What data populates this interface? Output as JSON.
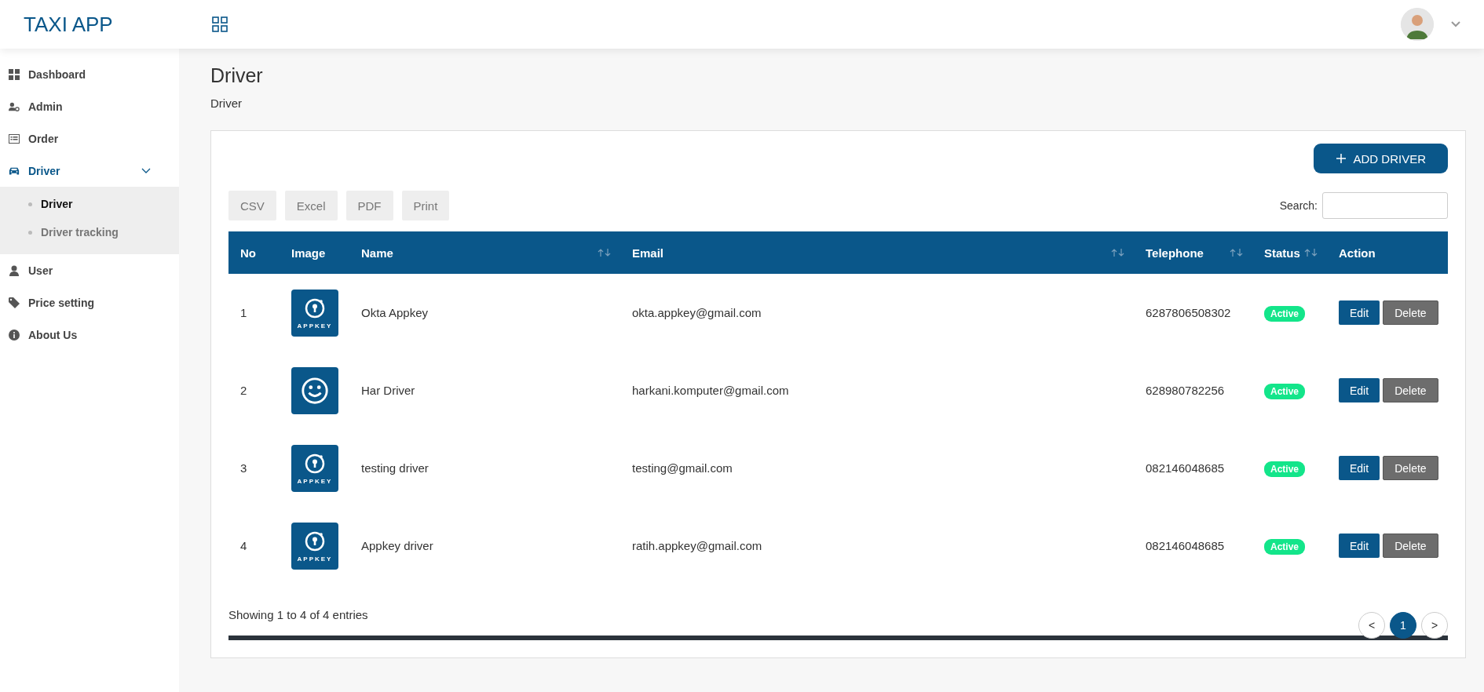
{
  "header": {
    "brand": "TAXI APP"
  },
  "sidebar": {
    "items": [
      {
        "kind": "dashboard",
        "label": "Dashboard",
        "selected": false
      },
      {
        "kind": "admin",
        "label": "Admin",
        "selected": false
      },
      {
        "kind": "order",
        "label": "Order",
        "selected": false
      },
      {
        "kind": "car",
        "label": "Driver",
        "selected": true,
        "expanded": true,
        "children": [
          {
            "label": "Driver",
            "selected": true
          },
          {
            "label": "Driver tracking",
            "selected": false
          }
        ]
      },
      {
        "kind": "user",
        "label": "User",
        "selected": false
      },
      {
        "kind": "tag",
        "label": "Price setting",
        "selected": false
      },
      {
        "kind": "info",
        "label": "About Us",
        "selected": false
      }
    ]
  },
  "page": {
    "title": "Driver",
    "breadcrumb": "Driver"
  },
  "add_button": "ADD DRIVER",
  "export_buttons": [
    "CSV",
    "Excel",
    "PDF",
    "Print"
  ],
  "search": {
    "label": "Search:"
  },
  "table": {
    "columns": [
      {
        "label": "No",
        "sortable": false
      },
      {
        "label": "Image",
        "sortable": false
      },
      {
        "label": "Name",
        "sortable": true
      },
      {
        "label": "Email",
        "sortable": true
      },
      {
        "label": "Telephone",
        "sortable": true
      },
      {
        "label": "Status",
        "sortable": true
      },
      {
        "label": "Action",
        "sortable": false
      }
    ],
    "rows": [
      {
        "no": "1",
        "kind": "appkey",
        "logo_text": "APPKEY",
        "name": "Okta Appkey",
        "email": "okta.appkey@gmail.com",
        "telephone": "6287806508302",
        "status": "Active",
        "actions": [
          "Edit",
          "Delete"
        ]
      },
      {
        "no": "2",
        "kind": "smiley",
        "name": "Har Driver",
        "email": "harkani.komputer@gmail.com",
        "telephone": "628980782256",
        "status": "Active",
        "actions": [
          "Edit",
          "Delete"
        ]
      },
      {
        "no": "3",
        "kind": "appkey",
        "logo_text": "APPKEY",
        "name": "testing driver",
        "email": "testing@gmail.com",
        "telephone": "082146048685",
        "status": "Active",
        "actions": [
          "Edit",
          "Delete"
        ]
      },
      {
        "no": "4",
        "kind": "appkey",
        "logo_text": "APPKEY",
        "name": "Appkey driver",
        "email": "ratih.appkey@gmail.com",
        "telephone": "082146048685",
        "status": "Active",
        "actions": [
          "Edit",
          "Delete"
        ]
      }
    ]
  },
  "info": "Showing 1 to 4 of 4 entries",
  "pagination": [
    {
      "label": "<",
      "selected": false
    },
    {
      "label": "1",
      "selected": true
    },
    {
      "label": ">",
      "selected": false
    }
  ]
}
